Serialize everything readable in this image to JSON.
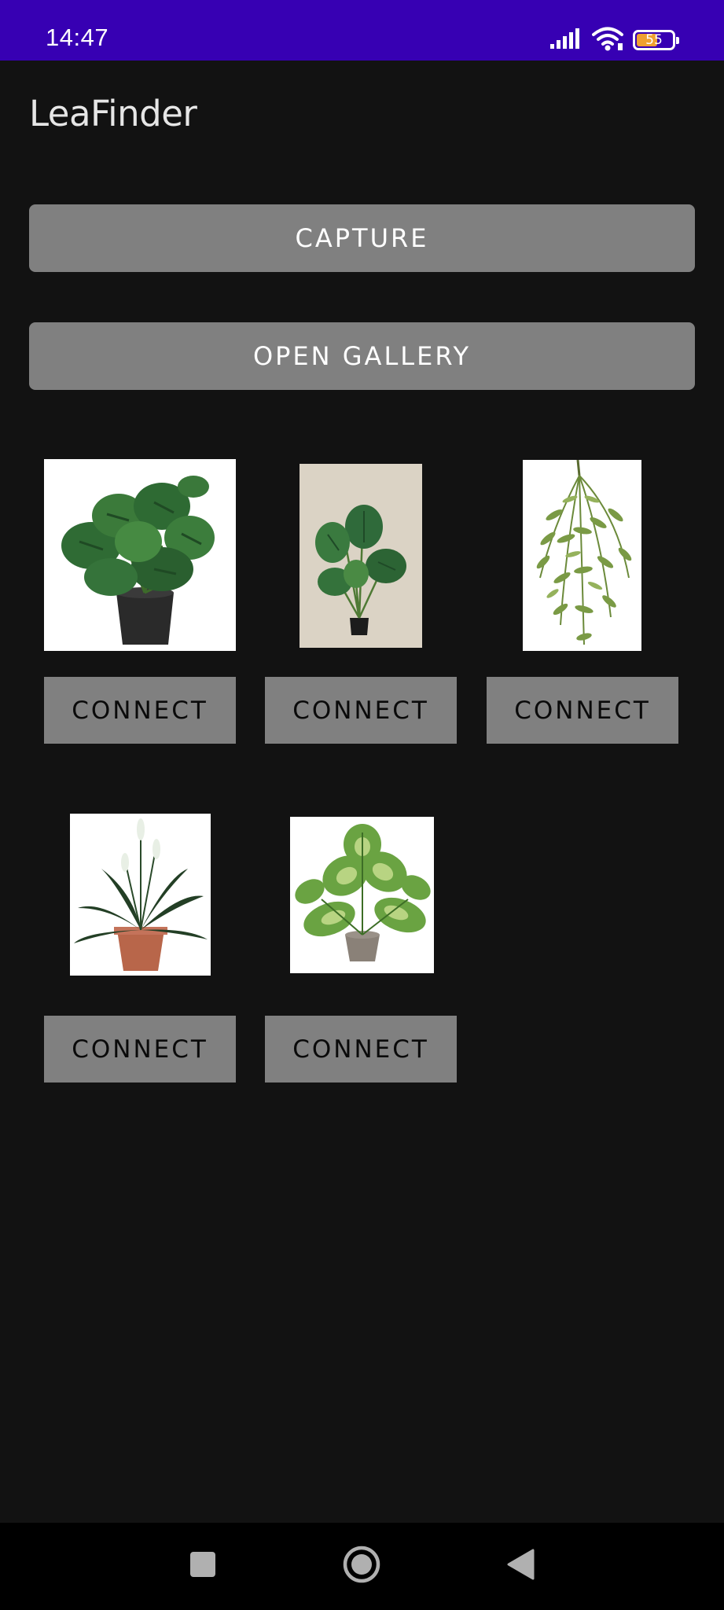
{
  "status_bar": {
    "time": "14:47",
    "battery_level": "55",
    "icons": [
      "signal-icon",
      "wifi-icon",
      "battery-icon"
    ]
  },
  "app": {
    "title": "LeaFinder"
  },
  "actions": {
    "capture_label": "CAPTURE",
    "open_gallery_label": "OPEN GALLERY"
  },
  "plants": [
    {
      "image": "monstera-black-pot-image",
      "connect_label": "CONNECT"
    },
    {
      "image": "monstera-beige-background-image",
      "connect_label": "CONNECT"
    },
    {
      "image": "hanging-fern-image",
      "connect_label": "CONNECT"
    },
    {
      "image": "peace-lily-terracotta-pot-image",
      "connect_label": "CONNECT"
    },
    {
      "image": "dieffenbachia-grey-pot-image",
      "connect_label": "CONNECT"
    }
  ],
  "navigation": {
    "buttons": [
      "recents-icon",
      "home-icon",
      "back-icon"
    ]
  },
  "colors": {
    "status_bar": "#3700b3",
    "background": "#121212",
    "button": "#808080",
    "battery_fill": "#f0a030"
  }
}
